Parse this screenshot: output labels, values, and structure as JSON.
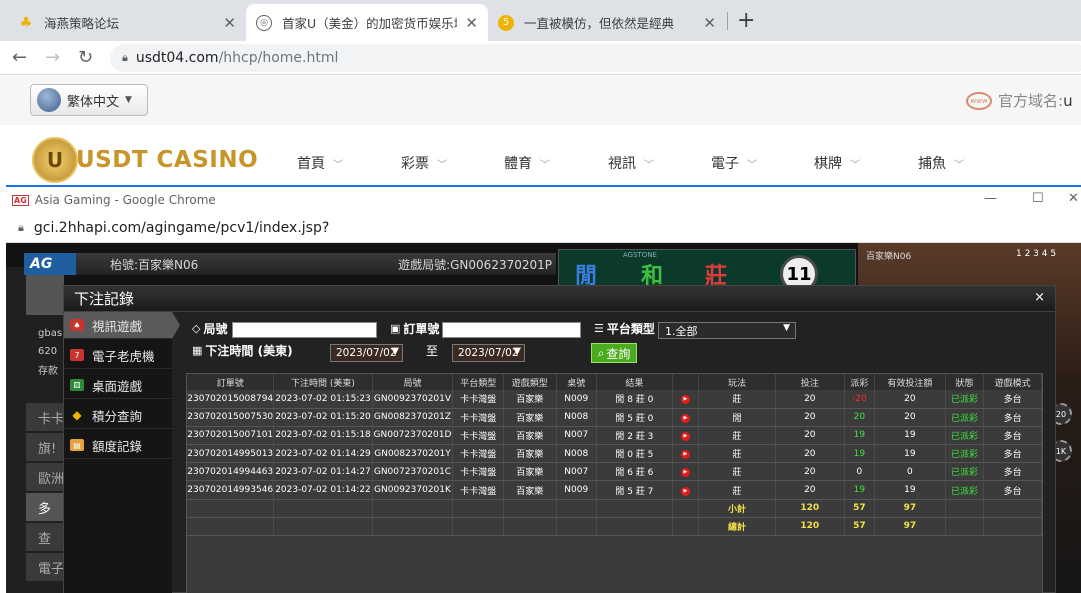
{
  "browser": {
    "tabs": [
      {
        "title": "海燕策略论坛",
        "icon": "paw-icon",
        "color": "#f0b400"
      },
      {
        "title": "首家U（美金）的加密货币娱乐城",
        "icon": "globe-icon"
      },
      {
        "title": "一直被模仿，但依然是經典",
        "icon": "coin-icon",
        "color": "#f0b400"
      }
    ],
    "url_host": "usdt04.com",
    "url_path": "/hhcp/home.html"
  },
  "site": {
    "language": "繁体中文",
    "official_domain_label": "官方域名:",
    "official_domain_value": "u",
    "logo_text": "USDT CASINO",
    "logo_mark": "U",
    "nav": [
      "首頁",
      "彩票",
      "體育",
      "視訊",
      "電子",
      "棋牌",
      "捕魚"
    ]
  },
  "inner_window": {
    "title": "Asia Gaming - Google Chrome",
    "app_icon": "AG",
    "url": "gci.2hhapi.com/agingame/pcv1/index.jsp?",
    "game": {
      "brand": "AG",
      "table_label": "枱號:百家樂N06",
      "round_label": "遊戲局號:GN0062370201P",
      "board_chars": [
        "閒",
        "和",
        "莊"
      ],
      "board_sub": "AGSTONE",
      "shoe_number": "11",
      "right_label": "百家樂N06",
      "right_nums": "1 2 3 4 5",
      "left_texts": [
        "gbas",
        "620",
        "存款",
        "卡卡",
        "旗!",
        "歐洲",
        "多",
        "查",
        "電子"
      ],
      "chips": [
        "20",
        "1K"
      ]
    }
  },
  "dialog": {
    "title": "下注記錄",
    "close": "×",
    "sidebar": [
      {
        "label": "視訊遊戲",
        "icon": "cards-icon",
        "active": true
      },
      {
        "label": "電子老虎機",
        "icon": "slot-icon"
      },
      {
        "label": "桌面遊戲",
        "icon": "dice-icon"
      },
      {
        "label": "積分查詢",
        "icon": "diamond-icon"
      },
      {
        "label": "額度記錄",
        "icon": "ledger-icon"
      }
    ],
    "filters": {
      "round_label": "局號",
      "order_label": "訂單號",
      "platform_label": "平台類型",
      "platform_value": "1.全部",
      "time_label": "下注時間 (美東)",
      "date_from": "2023/07/02",
      "to_label": "至",
      "date_to": "2023/07/02",
      "query_button": "查詢"
    },
    "table": {
      "headers": [
        "訂單號",
        "下注時間 (美東)",
        "局號",
        "平台類型",
        "遊戲類型",
        "桌號",
        "結果",
        "",
        "玩法",
        "投注",
        "派彩",
        "有效投注額",
        "狀態",
        "遊戲模式"
      ],
      "rows": [
        [
          "230702015008794",
          "2023-07-02 01:15:23",
          "GN0092370201V",
          "卡卡灣盤",
          "百家樂",
          "N009",
          "閒 8 莊 0",
          "莊",
          "20",
          "-20",
          "20",
          "已派彩",
          "多台"
        ],
        [
          "230702015007530",
          "2023-07-02 01:15:20",
          "GN0082370201Z",
          "卡卡灣盤",
          "百家樂",
          "N008",
          "閒 5 莊 0",
          "閒",
          "20",
          "20",
          "20",
          "已派彩",
          "多台"
        ],
        [
          "230702015007101",
          "2023-07-02 01:15:18",
          "GN0072370201D",
          "卡卡灣盤",
          "百家樂",
          "N007",
          "閒 2 莊 3",
          "莊",
          "20",
          "19",
          "19",
          "已派彩",
          "多台"
        ],
        [
          "230702014995013",
          "2023-07-02 01:14:29",
          "GN0082370201Y",
          "卡卡灣盤",
          "百家樂",
          "N008",
          "閒 0 莊 5",
          "莊",
          "20",
          "19",
          "19",
          "已派彩",
          "多台"
        ],
        [
          "230702014994463",
          "2023-07-02 01:14:27",
          "GN0072370201C",
          "卡卡灣盤",
          "百家樂",
          "N007",
          "閒 6 莊 6",
          "莊",
          "20",
          "0",
          "0",
          "已派彩",
          "多台"
        ],
        [
          "230702014993546",
          "2023-07-02 01:14:22",
          "GN0092370201K",
          "卡卡灣盤",
          "百家樂",
          "N009",
          "閒 5 莊 7",
          "莊",
          "20",
          "19",
          "19",
          "已派彩",
          "多台"
        ]
      ],
      "subtotal": {
        "label": "小計",
        "bet": "120",
        "payout": "57",
        "valid": "97"
      },
      "total": {
        "label": "總計",
        "bet": "120",
        "payout": "57",
        "valid": "97"
      }
    }
  },
  "colors": {
    "accent": "#4caa1f",
    "negative": "#ff2b2b",
    "positive": "#3fe23f",
    "sum": "#f4e04a"
  }
}
